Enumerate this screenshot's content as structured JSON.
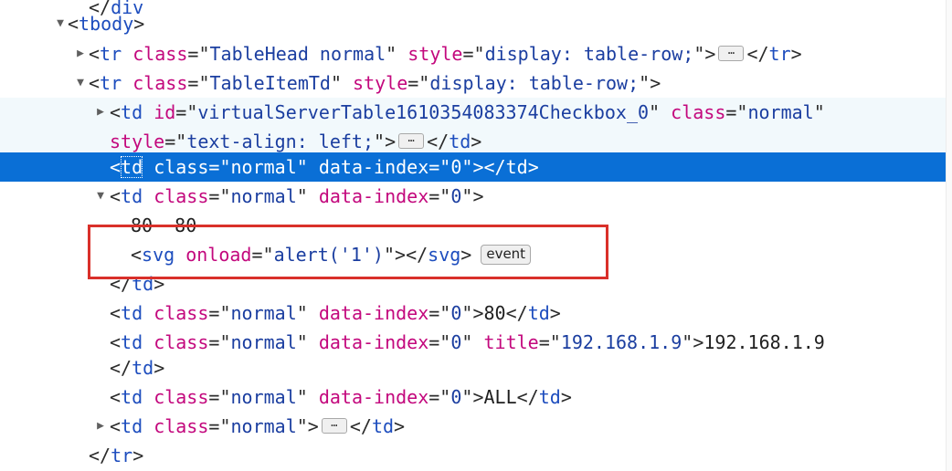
{
  "dom_tree": {
    "nodes": [
      {
        "id": "div-close",
        "tag": "div",
        "closing": true,
        "clipped": true
      },
      {
        "id": "tbody-open",
        "tag": "tbody",
        "twisty": "expanded"
      },
      {
        "id": "tr-tablehead",
        "tag": "tr",
        "twisty": "collapsed",
        "attrs": [
          {
            "name": "class",
            "value": "TableHead normal"
          },
          {
            "name": "style",
            "value": "display: table-row;"
          }
        ],
        "collapsed_children": true,
        "close_tag": "tr"
      },
      {
        "id": "tr-tableitemtd",
        "tag": "tr",
        "twisty": "expanded",
        "attrs": [
          {
            "name": "class",
            "value": "TableItemTd"
          },
          {
            "name": "style",
            "value": "display: table-row;"
          }
        ]
      },
      {
        "id": "td-checkbox",
        "tag": "td",
        "twisty": "collapsed",
        "highlight": "hover",
        "attrs": [
          {
            "name": "id",
            "value": "virtualServerTable1610354083374Checkbox_0"
          },
          {
            "name": "class",
            "value": "normal"
          }
        ],
        "wrapped_attrs": [
          {
            "name": "style",
            "value": "text-align: left;"
          }
        ],
        "collapsed_children": true,
        "close_tag": "td"
      },
      {
        "id": "td-selected",
        "tag": "td",
        "highlight": "selected",
        "attrs": [
          {
            "name": "class",
            "value": "normal"
          },
          {
            "name": "data-index",
            "value": "0"
          }
        ],
        "close_tag": "td"
      },
      {
        "id": "td-expanded",
        "tag": "td",
        "twisty": "expanded",
        "attrs": [
          {
            "name": "class",
            "value": "normal"
          },
          {
            "name": "data-index",
            "value": "0"
          }
        ]
      },
      {
        "id": "text-80-80",
        "text": "80  80",
        "clipped": true
      },
      {
        "id": "svg-onload",
        "tag": "svg",
        "attrs": [
          {
            "name": "onload",
            "value": "alert('1')"
          }
        ],
        "close_tag": "svg",
        "badge": "event"
      },
      {
        "id": "td-close",
        "tag": "td",
        "closing": true
      },
      {
        "id": "td-80",
        "tag": "td",
        "attrs": [
          {
            "name": "class",
            "value": "normal"
          },
          {
            "name": "data-index",
            "value": "0"
          }
        ],
        "text": "80",
        "close_tag": "td"
      },
      {
        "id": "td-ip",
        "tag": "td",
        "attrs": [
          {
            "name": "class",
            "value": "normal"
          },
          {
            "name": "data-index",
            "value": "0"
          },
          {
            "name": "title",
            "value": "192.168.1.9"
          }
        ],
        "text": "192.168.1.9"
      },
      {
        "id": "td-ip-close",
        "tag": "td",
        "closing": true
      },
      {
        "id": "td-all",
        "tag": "td",
        "attrs": [
          {
            "name": "class",
            "value": "normal"
          },
          {
            "name": "data-index",
            "value": "0"
          }
        ],
        "text": "ALL",
        "close_tag": "td"
      },
      {
        "id": "td-last",
        "tag": "td",
        "twisty": "collapsed",
        "attrs": [
          {
            "name": "class",
            "value": "normal"
          }
        ],
        "collapsed_children": true,
        "close_tag": "td"
      },
      {
        "id": "tr-close",
        "tag": "tr",
        "closing": true
      }
    ]
  },
  "annotation": {
    "color": "#d9302a",
    "target": "svg-onload"
  },
  "colors": {
    "tag": "#1d4dbe",
    "attribute_name": "#c3087d",
    "attribute_value": "#1b3ea0",
    "selected_row": "#0a6fd6",
    "hover_row": "#f2f9fc"
  }
}
